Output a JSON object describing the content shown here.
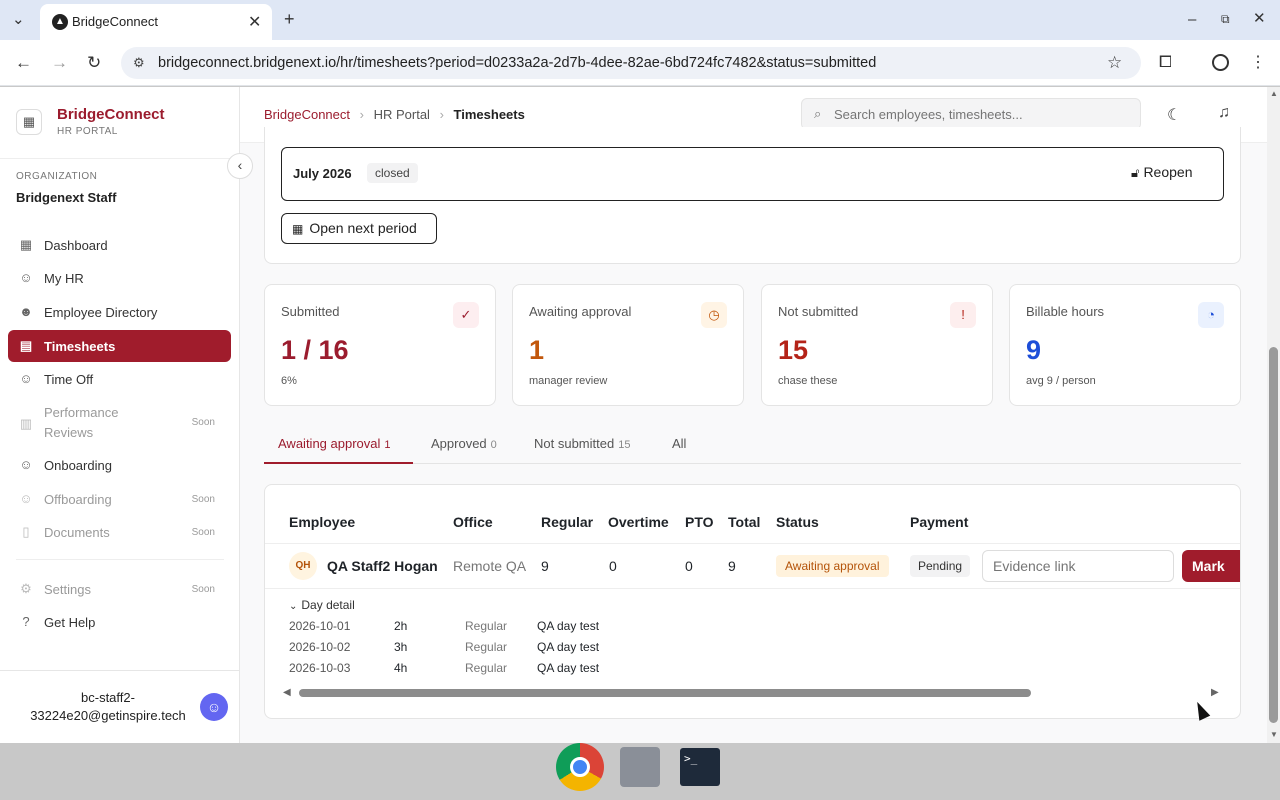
{
  "browser": {
    "tab_title": "BridgeConnect",
    "url": "bridgeconnect.bridgenext.io/hr/timesheets?period=d0233a2a-2d7b-4dee-82ae-6bd724fc7482&status=submitted"
  },
  "sidebar": {
    "brand": "BridgeConnect",
    "brand_sub": "HR PORTAL",
    "org_label": "ORGANIZATION",
    "org_name": "Bridgenext Staff",
    "items": [
      {
        "label": "Dashboard",
        "icon": "grid-icon"
      },
      {
        "label": "My HR",
        "icon": "user-icon"
      },
      {
        "label": "Employee Directory",
        "icon": "users-icon"
      },
      {
        "label": "Timesheets",
        "icon": "calendar-clock-icon"
      },
      {
        "label": "Time Off",
        "icon": "user-clock-icon"
      },
      {
        "label": "Performance Reviews",
        "icon": "chart-icon",
        "badge": "Soon"
      },
      {
        "label": "Onboarding",
        "icon": "user-plus-icon"
      },
      {
        "label": "Offboarding",
        "icon": "user-minus-icon",
        "badge": "Soon"
      },
      {
        "label": "Documents",
        "icon": "file-icon",
        "badge": "Soon"
      },
      {
        "label": "Settings",
        "icon": "gear-icon",
        "badge": "Soon"
      },
      {
        "label": "Get Help",
        "icon": "help-icon"
      }
    ],
    "user_line1": "bc-staff2-",
    "user_line2": "33224e20@getinspire.tech"
  },
  "header": {
    "breadcrumb": [
      "BridgeConnect",
      "HR Portal",
      "Timesheets"
    ],
    "search_placeholder": "Search employees, timesheets..."
  },
  "period": {
    "name": "July 2026",
    "status": "closed",
    "reopen_label": "Reopen",
    "open_next_label": "Open next period"
  },
  "stats": [
    {
      "label": "Submitted",
      "value": "1 / 16",
      "sub": "6%",
      "color": "#9b1c2e",
      "icon": "check-circle-icon"
    },
    {
      "label": "Awaiting approval",
      "value": "1",
      "sub": "manager review",
      "color": "#c2570c",
      "icon": "clock-icon"
    },
    {
      "label": "Not submitted",
      "value": "15",
      "sub": "chase these",
      "color": "#b42318",
      "icon": "alert-circle-icon"
    },
    {
      "label": "Billable hours",
      "value": "9",
      "sub": "avg 9 / person",
      "color": "#1d4ed8",
      "icon": "timer-icon"
    }
  ],
  "tabs": [
    {
      "label": "Awaiting approval",
      "count": "1"
    },
    {
      "label": "Approved",
      "count": "0"
    },
    {
      "label": "Not submitted",
      "count": "15"
    },
    {
      "label": "All",
      "count": ""
    }
  ],
  "table": {
    "columns": [
      "Employee",
      "Office",
      "Regular",
      "Overtime",
      "PTO",
      "Total",
      "Status",
      "Payment"
    ],
    "row": {
      "initials": "QH",
      "employee": "QA Staff2 Hogan",
      "office": "Remote QA",
      "regular": "9",
      "overtime": "0",
      "pto": "0",
      "total": "9",
      "status": "Awaiting approval",
      "payment": "Pending",
      "evidence_placeholder": "Evidence link",
      "mark_label": "Mark"
    },
    "day_detail_label": "Day detail",
    "days": [
      {
        "date": "2026-10-01",
        "hours": "2h",
        "type": "Regular",
        "note": "QA day test"
      },
      {
        "date": "2026-10-02",
        "hours": "3h",
        "type": "Regular",
        "note": "QA day test"
      },
      {
        "date": "2026-10-03",
        "hours": "4h",
        "type": "Regular",
        "note": "QA day test"
      }
    ]
  },
  "colors": {
    "brand": "#a01c2c",
    "accent_text": "#9b1c2e"
  }
}
